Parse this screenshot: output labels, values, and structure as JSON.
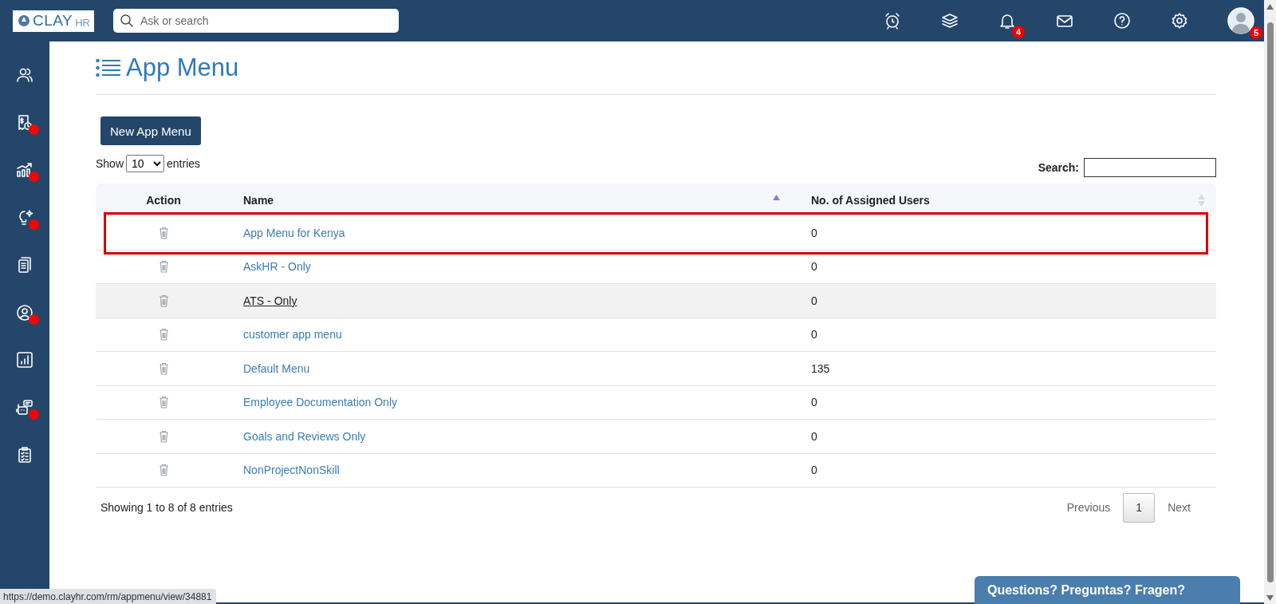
{
  "topbar": {
    "logo": {
      "text": "CLAY",
      "suffix": "HR"
    },
    "search": {
      "placeholder": "Ask or search"
    },
    "icons": [
      {
        "kind": "alarm"
      },
      {
        "kind": "layers"
      },
      {
        "kind": "bell",
        "badge": "4"
      },
      {
        "kind": "mail"
      },
      {
        "kind": "help"
      },
      {
        "kind": "settings"
      },
      {
        "kind": "avatar",
        "badge": "5"
      }
    ]
  },
  "sidebar": {
    "items": [
      {
        "kind": "users",
        "alert": false
      },
      {
        "kind": "payroll",
        "alert": true
      },
      {
        "kind": "growth",
        "alert": true
      },
      {
        "kind": "idea",
        "alert": true
      },
      {
        "kind": "documents",
        "alert": false
      },
      {
        "kind": "profile",
        "alert": true
      },
      {
        "kind": "report",
        "alert": false
      },
      {
        "kind": "bot",
        "alert": true
      },
      {
        "kind": "checklist",
        "alert": false
      }
    ]
  },
  "page": {
    "title": "App Menu",
    "new_button": "New App Menu",
    "show": {
      "label": "Show",
      "value": "10",
      "suffix": "entries"
    },
    "search": {
      "label": "Search:"
    }
  },
  "table": {
    "columns": [
      {
        "label": "Action",
        "kind": "plain"
      },
      {
        "label": "Name",
        "kind": "ascending"
      },
      {
        "label": "No. of Assigned Users",
        "kind": "sortable"
      }
    ],
    "rows": [
      {
        "name": "App Menu for Kenya",
        "users": "0",
        "outlined": true,
        "hovered": false
      },
      {
        "name": "AskHR - Only",
        "users": "0",
        "outlined": false,
        "hovered": false
      },
      {
        "name": "ATS - Only",
        "users": "0",
        "outlined": false,
        "hovered": true
      },
      {
        "name": "customer app menu",
        "users": "0",
        "outlined": false,
        "hovered": false
      },
      {
        "name": "Default Menu",
        "users": "135",
        "outlined": false,
        "hovered": false
      },
      {
        "name": "Employee Documentation Only",
        "users": "0",
        "outlined": false,
        "hovered": false
      },
      {
        "name": "Goals and Reviews Only",
        "users": "0",
        "outlined": false,
        "hovered": false
      },
      {
        "name": "NonProjectNonSkill",
        "users": "0",
        "outlined": false,
        "hovered": false
      }
    ]
  },
  "footer": {
    "info": "Showing 1 to 8 of 8 entries",
    "pagination": [
      {
        "kind": "prev",
        "label": "Previous",
        "selected": false
      },
      {
        "kind": "page",
        "label": "1",
        "selected": true
      },
      {
        "kind": "next",
        "label": "Next",
        "selected": false
      }
    ]
  },
  "status_url": "https://demo.clayhr.com/rm/appmenu/view/34881",
  "chat_button": "Questions? Preguntas? Fragen?"
}
